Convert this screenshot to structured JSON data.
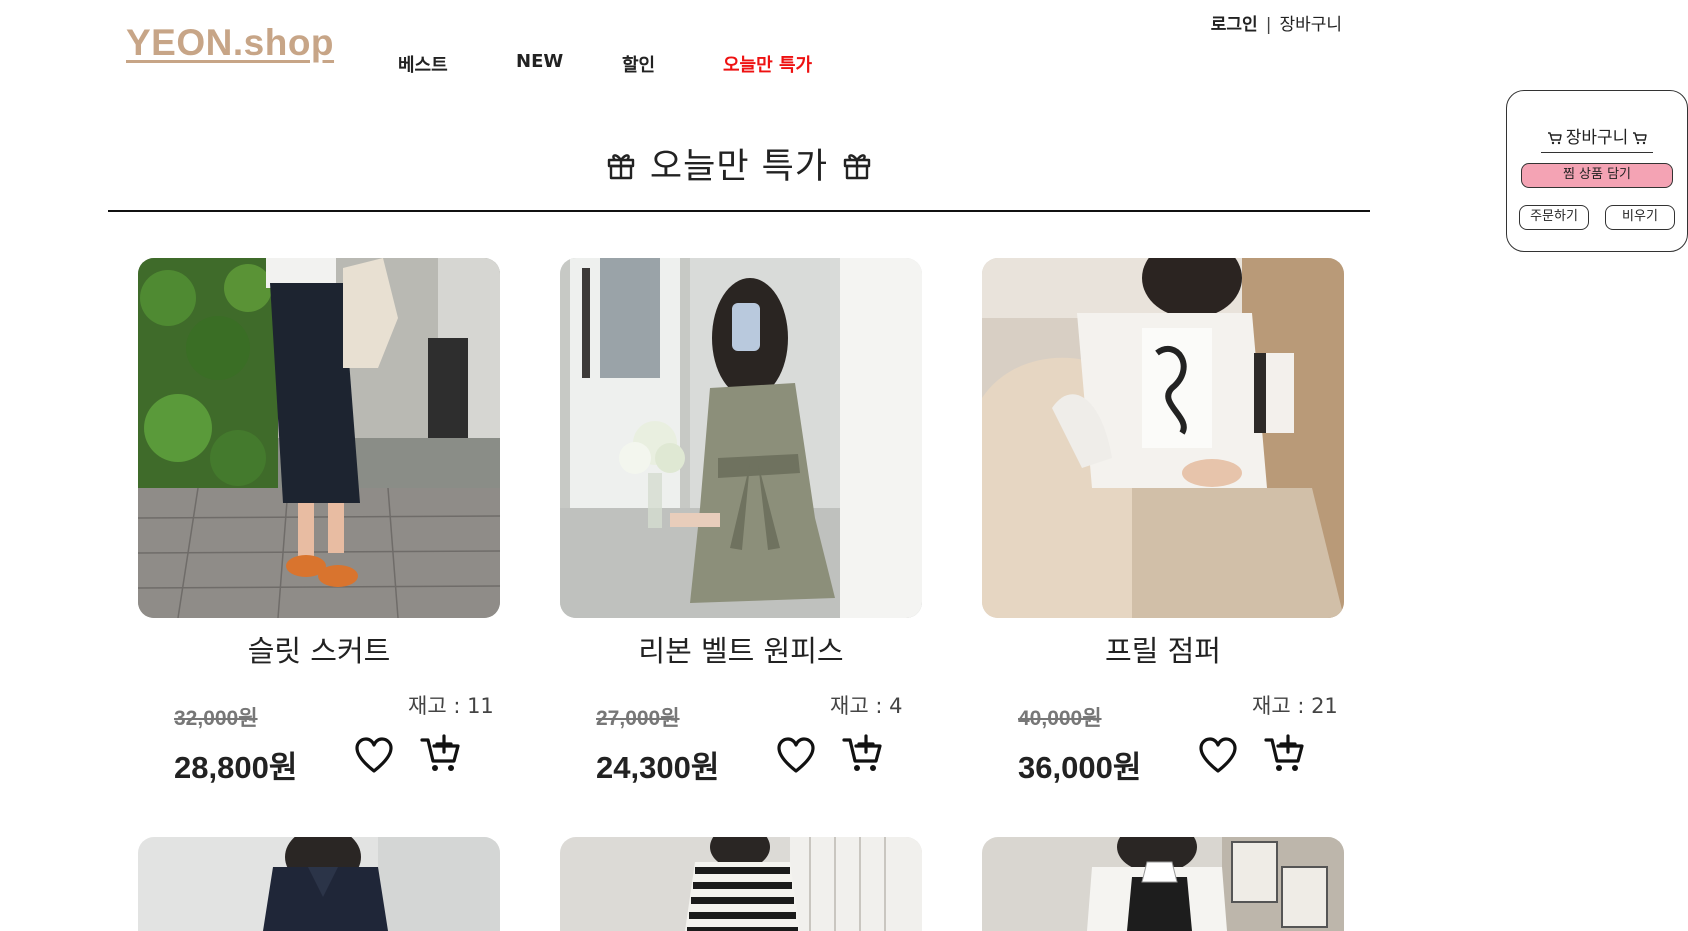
{
  "brand": {
    "logo": "YEON.shop",
    "accent": "#c7a587"
  },
  "top_links": {
    "login": "로그인",
    "separator": "|",
    "cart": "장바구니"
  },
  "nav": [
    {
      "label": "베스트"
    },
    {
      "label": "NEW"
    },
    {
      "label": "할인"
    },
    {
      "label": "오늘만 특가",
      "color": "#ee1111"
    }
  ],
  "page": {
    "title": "오늘만 특가",
    "title_icon": "gift-icon"
  },
  "products": [
    {
      "name": "슬릿 스커트",
      "stock": "재고 : 11",
      "old_price": "32,000원",
      "price": "28,800원"
    },
    {
      "name": "리본 벨트 원피스",
      "stock": "재고 : 4",
      "old_price": "27,000원",
      "price": "24,300원"
    },
    {
      "name": "프릴 점퍼",
      "stock": "재고 : 21",
      "old_price": "40,000원",
      "price": "36,000원"
    }
  ],
  "cart_panel": {
    "title": "장바구니",
    "add_wish_label": "찜 상품 담기",
    "order_label": "주문하기",
    "clear_label": "비우기",
    "add_btn_color": "#f4a3b4"
  }
}
